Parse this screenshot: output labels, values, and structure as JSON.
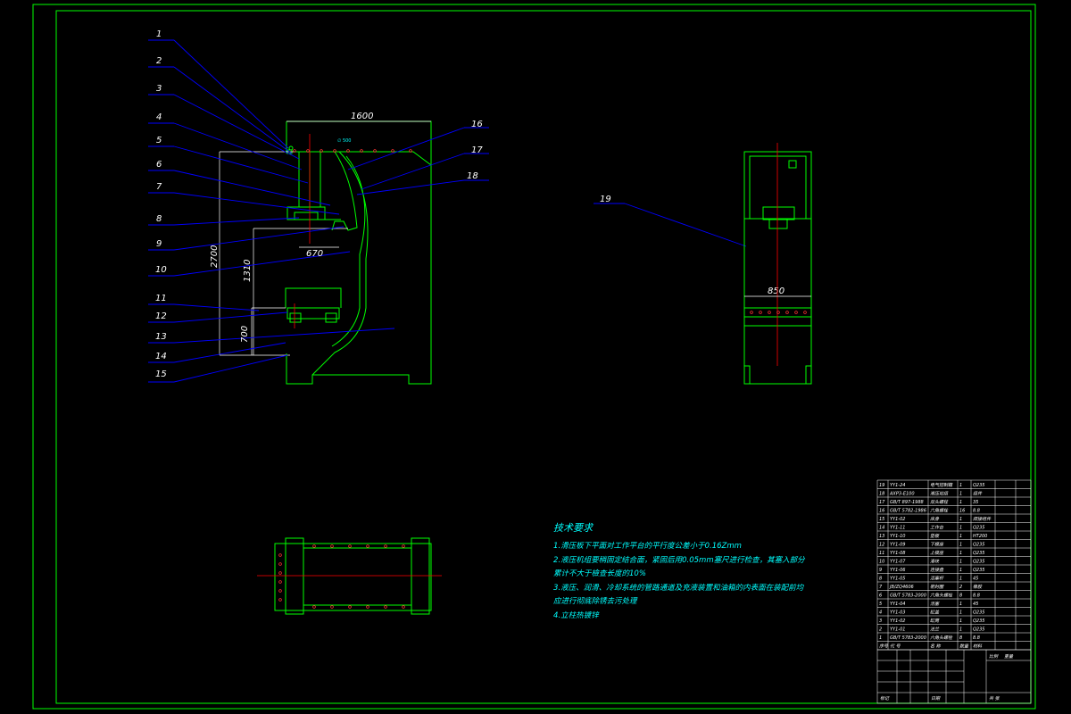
{
  "colors": {
    "background": "#000000",
    "frame": "#00ff00",
    "leader": "#0000ff",
    "text": "#ffffff",
    "centerline": "#ff0000",
    "tech_text": "#00ffff",
    "dimension": "#ffff00"
  },
  "balloons": [
    "1",
    "2",
    "3",
    "4",
    "5",
    "6",
    "7",
    "8",
    "9",
    "10",
    "11",
    "12",
    "13",
    "14",
    "15",
    "16",
    "17",
    "18",
    "19"
  ],
  "dimensions": {
    "overall_width": "1600",
    "overall_height": "2700",
    "mid_height": "1310",
    "throat": "670",
    "bed_height": "700",
    "side_width": "850"
  },
  "technical_requirements": {
    "title": "技术要求",
    "lines": [
      "1.滑压板下平面对工作平台的平行度公差小于0.16Zmm",
      "2.液压机组要稍固定结合面，紧固后用0.05mm塞尺进行检查，其塞入部分",
      "累计不大于檢查长度的10%",
      "3.液压、润滑、冷却系统的管路通道及充液装置和油箱的内表面在装配前均",
      "应进行彻底除锈去污处理",
      "4.立柱热镀锌"
    ]
  },
  "bom_rows": [
    {
      "no": "19",
      "code": "YY1-24",
      "name": "电气控制箱",
      "qty": "1",
      "mat": "Q235"
    },
    {
      "no": "18",
      "code": "AXP3-E100",
      "name": "液压站组",
      "qty": "1",
      "mat": "组件"
    },
    {
      "no": "17",
      "code": "GB/T 897-1988",
      "name": "双头螺柱",
      "qty": "1",
      "mat": "35"
    },
    {
      "no": "16",
      "code": "GB/T 5782-1986",
      "name": "六角螺栓",
      "qty": "16",
      "mat": "8.8"
    },
    {
      "no": "15",
      "code": "YY1-02",
      "name": "床身",
      "qty": "1",
      "mat": "焊接组件"
    },
    {
      "no": "14",
      "code": "YY1-11",
      "name": "工作台",
      "qty": "1",
      "mat": "Q235"
    },
    {
      "no": "13",
      "code": "YY1-10",
      "name": "垫板",
      "qty": "1",
      "mat": "HT200"
    },
    {
      "no": "12",
      "code": "YY1-09",
      "name": "下模座",
      "qty": "1",
      "mat": "Q235"
    },
    {
      "no": "11",
      "code": "YY1-08",
      "name": "上模座",
      "qty": "1",
      "mat": "Q235"
    },
    {
      "no": "10",
      "code": "YY1-07",
      "name": "滑块",
      "qty": "1",
      "mat": "Q235"
    },
    {
      "no": "9",
      "code": "YY1-06",
      "name": "连接盘",
      "qty": "1",
      "mat": "Q235"
    },
    {
      "no": "8",
      "code": "YY1-05",
      "name": "活塞杆",
      "qty": "1",
      "mat": "45"
    },
    {
      "no": "7",
      "code": "JB/ZQ4606",
      "name": "密封圈",
      "qty": "2",
      "mat": "橡胶"
    },
    {
      "no": "6",
      "code": "GB/T 5783-2000",
      "name": "六角头螺栓",
      "qty": "8",
      "mat": "8.8"
    },
    {
      "no": "5",
      "code": "YY1-04",
      "name": "活塞",
      "qty": "1",
      "mat": "45"
    },
    {
      "no": "4",
      "code": "YY1-03",
      "name": "缸盖",
      "qty": "1",
      "mat": "Q235"
    },
    {
      "no": "3",
      "code": "YY1-02",
      "name": "缸筒",
      "qty": "1",
      "mat": "Q235"
    },
    {
      "no": "2",
      "code": "YY1-01",
      "name": "法兰",
      "qty": "1",
      "mat": "Q235"
    },
    {
      "no": "1",
      "code": "GB/T 5783-2000",
      "name": "六角头螺栓",
      "qty": "8",
      "mat": "8.8"
    }
  ],
  "bom_header": {
    "no": "序号",
    "code": "代 号",
    "name": "名 称",
    "qty": "数量",
    "mat": "材料"
  },
  "title_block": {
    "scale_label": "比例",
    "weight_label": "重量",
    "sheet_label": "共 张",
    "mark": "标记",
    "date": "日期"
  }
}
